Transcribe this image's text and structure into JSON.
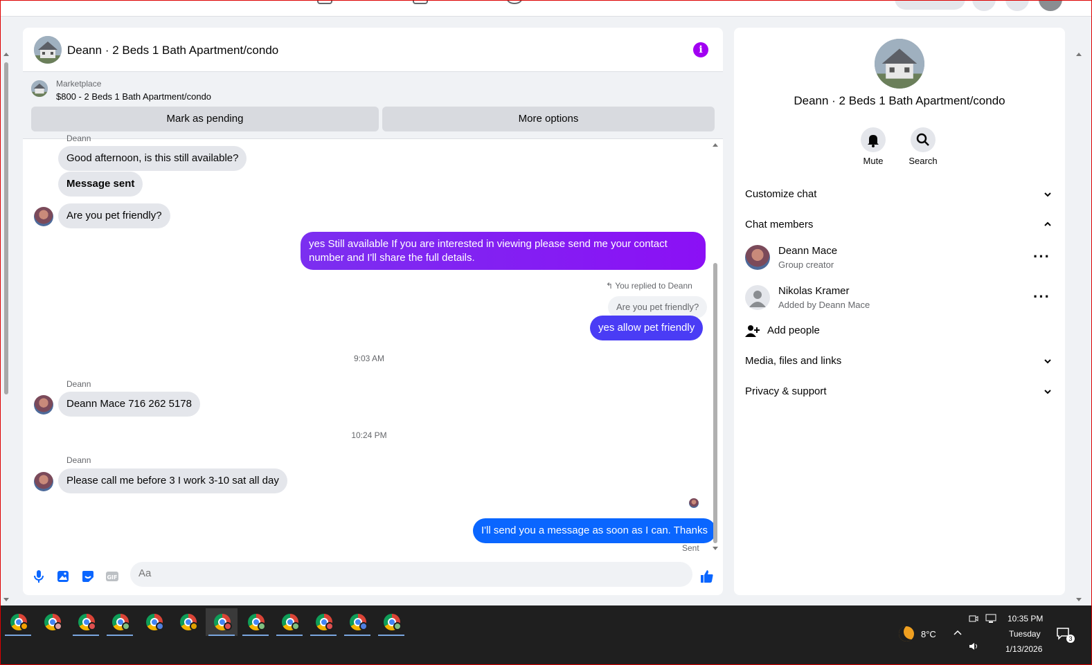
{
  "chat": {
    "title": "Deann · 2 Beds 1 Bath Apartment/condo",
    "marketplace_label": "Marketplace",
    "marketplace_item": "$800 - 2 Beds 1 Bath Apartment/condo",
    "mark_pending": "Mark as pending",
    "more_options": "More options",
    "sender_top": "Deann",
    "msg1": "Good afternoon, is this still available?",
    "msg2": "Message sent",
    "msg3": "Are you pet friendly?",
    "out1_line1": "yes Still available If you are interested in viewing please send me your contact",
    "out1_line2": "number and I'll share the full details.",
    "replied_label": "You replied to Deann",
    "quote": "Are you pet friendly?",
    "out2": "yes allow  pet friendly",
    "time1": "9:03 AM",
    "sender2": "Deann",
    "msg4": "Deann Mace 716 262 5178",
    "time2": "10:24 PM",
    "sender3": "Deann",
    "msg5": "Please call me before 3 I work 3-10 sat all day",
    "out3": "I'll send you a message as soon as I can. Thanks",
    "status": "Sent",
    "composer_placeholder": "Aa"
  },
  "side": {
    "title": "Deann · 2 Beds 1 Bath Apartment/condo",
    "mute": "Mute",
    "search": "Search",
    "customize": "Customize chat",
    "members_heading": "Chat members",
    "member1_name": "Deann Mace",
    "member1_sub": "Group creator",
    "member2_name": "Nikolas Kramer",
    "member2_sub": "Added by Deann Mace",
    "add_people": "Add people",
    "media": "Media, files and links",
    "privacy": "Privacy & support"
  },
  "taskbar": {
    "weather": "8°C",
    "time": "10:35 PM",
    "day": "Tuesday",
    "date": "1/13/2026",
    "notif_count": "3",
    "badge_colors": [
      "#f4a000",
      "#e0a0a0",
      "#e05050",
      "#80c080",
      "#5080e0",
      "#e0a000",
      "#e05050",
      "#80c080",
      "#80c080",
      "#e05050",
      "#5080e0",
      "#80c080"
    ]
  },
  "colors": {
    "accent": "#0a66ff",
    "purple": "#8b10f5",
    "info": "#a100f2"
  }
}
